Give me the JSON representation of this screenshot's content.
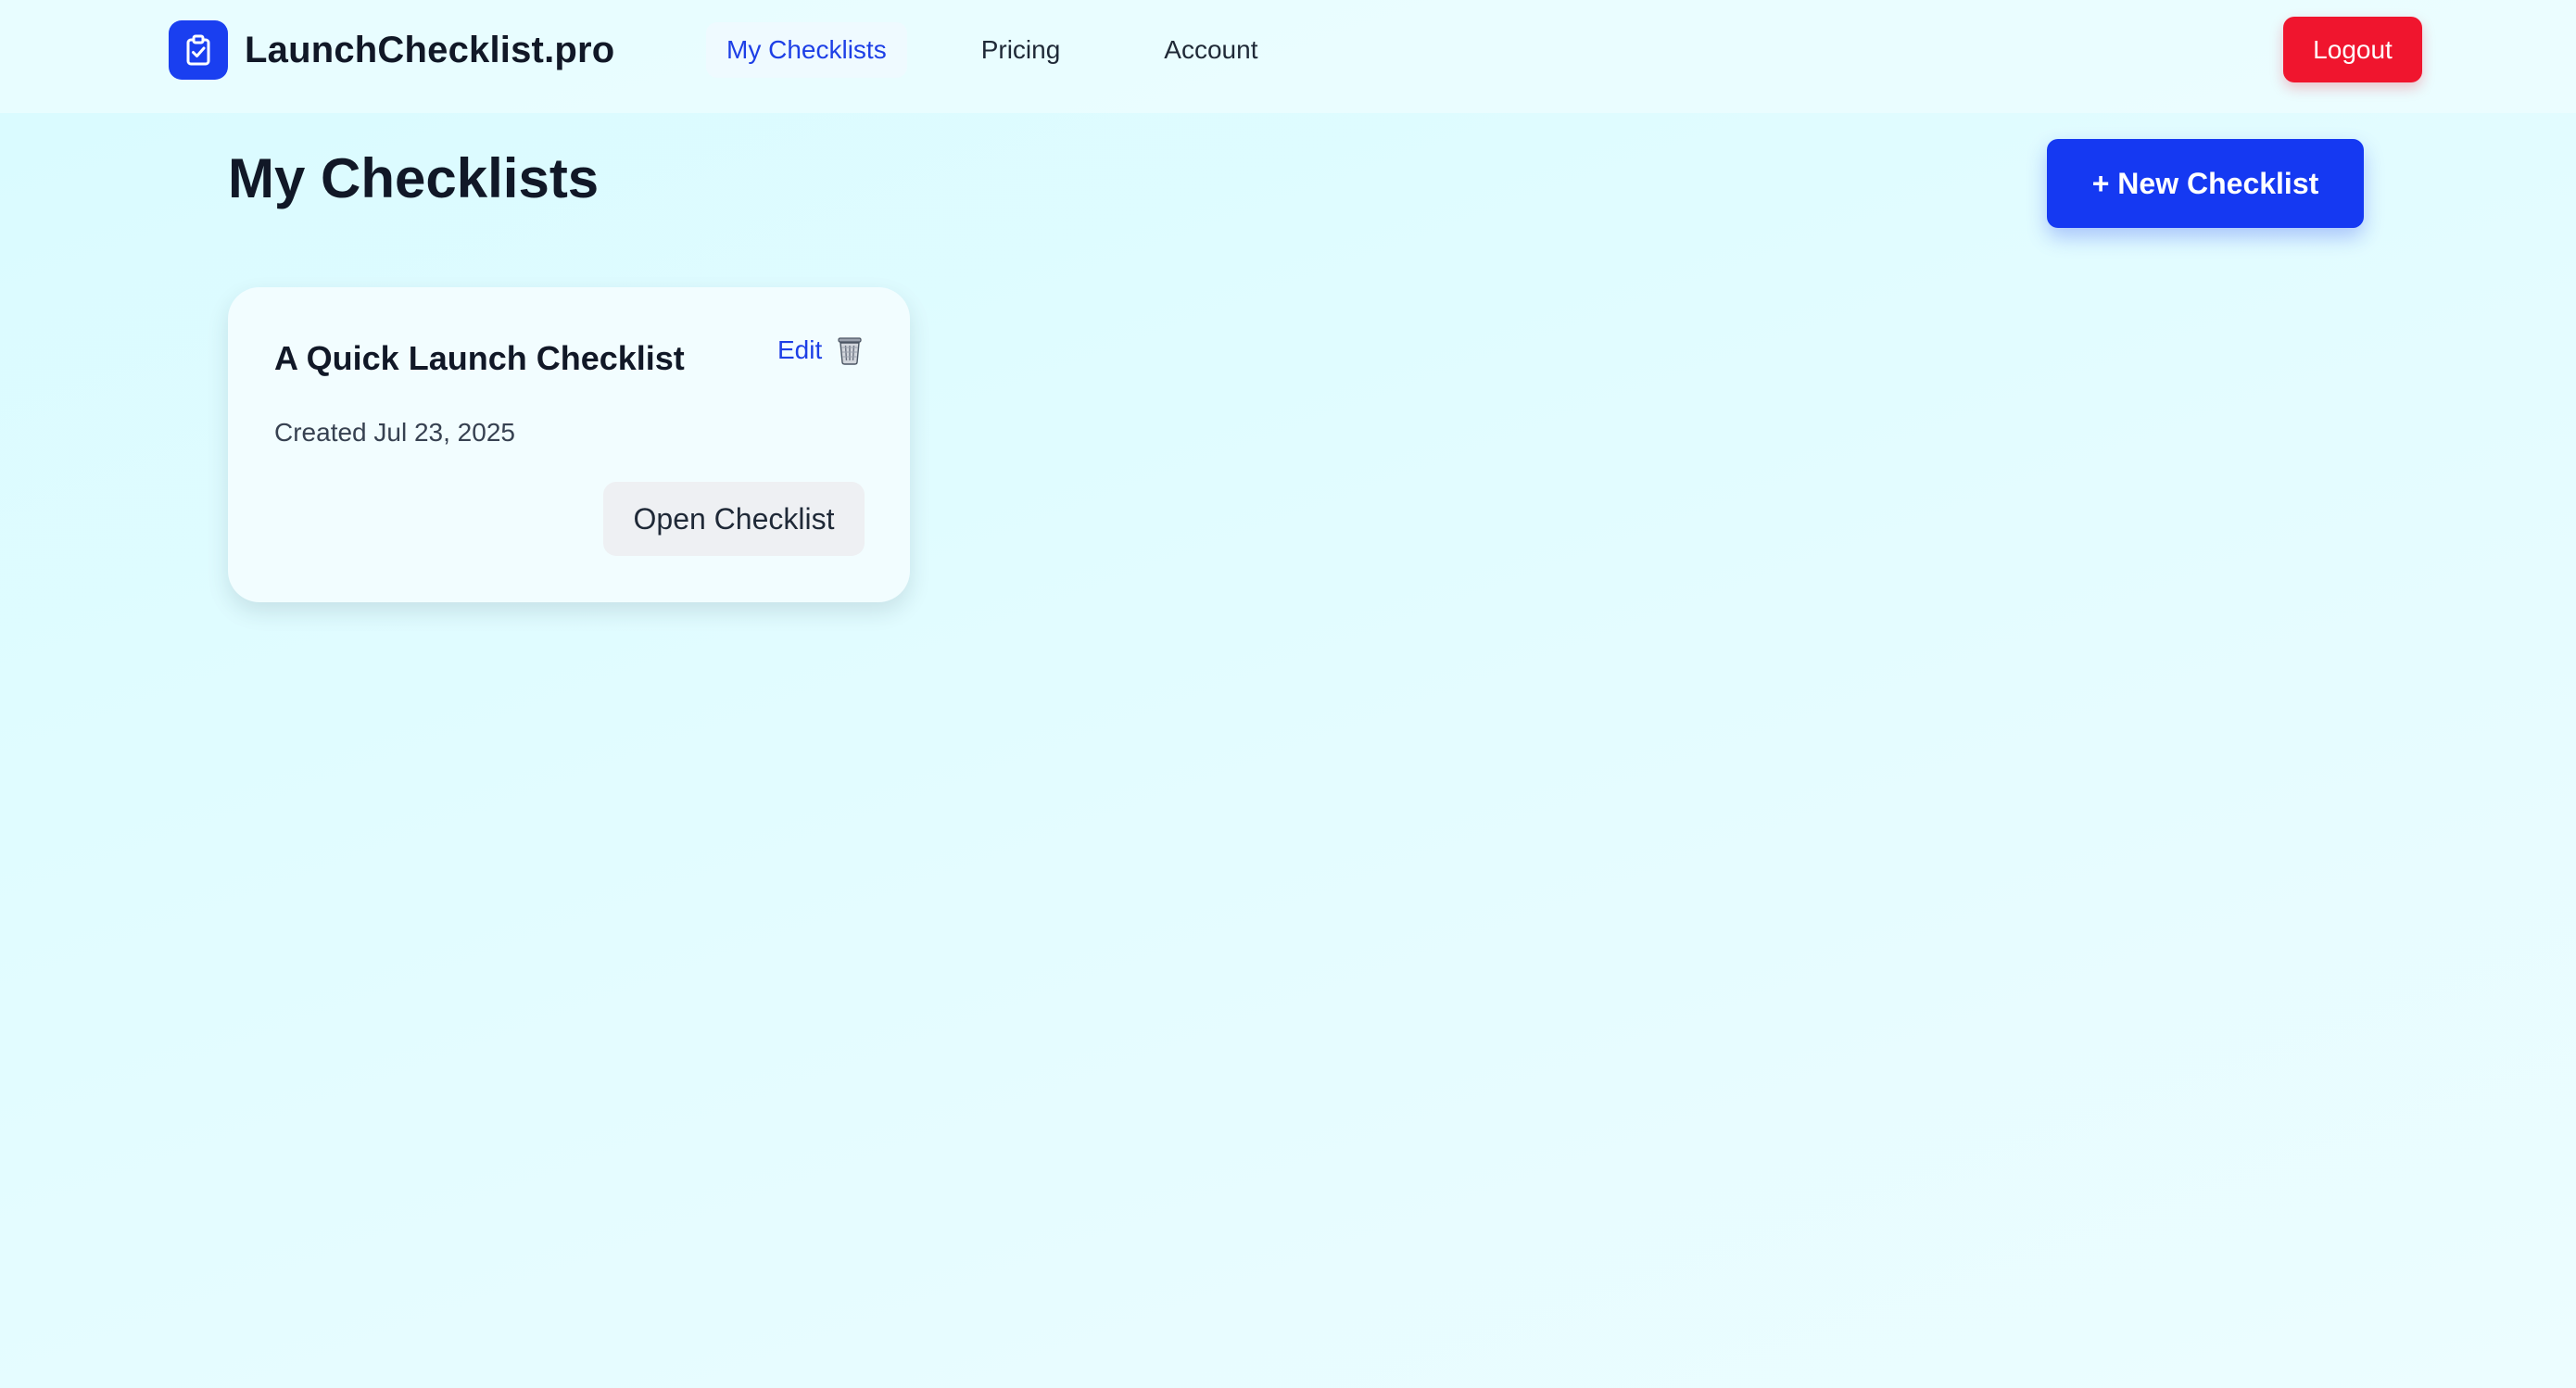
{
  "brand": {
    "name": "LaunchChecklist.pro",
    "logo_icon": "clipboard-check-icon",
    "logo_color": "#1a3ff0"
  },
  "nav": {
    "items": [
      {
        "label": "My Checklists",
        "active": true
      },
      {
        "label": "Pricing",
        "active": false
      },
      {
        "label": "Account",
        "active": false
      }
    ],
    "logout_label": "Logout",
    "logout_color": "#f0152e"
  },
  "header": {
    "title": "My Checklists",
    "new_button_label": "+ New Checklist",
    "accent_color": "#1539f2"
  },
  "checklists": [
    {
      "title": "A Quick Launch Checklist",
      "created": "Created Jul 23, 2025",
      "edit_label": "Edit",
      "delete_icon": "trash-icon",
      "open_label": "Open Checklist"
    }
  ]
}
